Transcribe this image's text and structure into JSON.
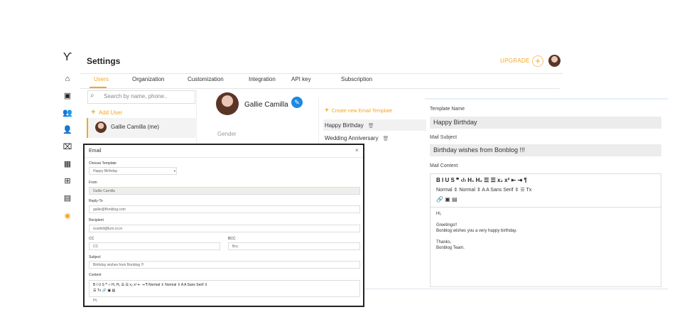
{
  "sidebar": {
    "icons": [
      "logo-icon",
      "home-icon",
      "contacts-icon",
      "team-icon",
      "add-user-icon",
      "briefcase-icon",
      "calendar-icon",
      "cart-icon",
      "reports-icon",
      "settings-icon"
    ]
  },
  "header": {
    "title": "Settings",
    "upgrade": "UPGRADE",
    "plus": "+"
  },
  "tabs": [
    "Users",
    "Organization",
    "Customization",
    "Integration",
    "API key",
    "Subscription"
  ],
  "users": {
    "search_placeholder": "Search by name, phone..",
    "add_user": "Add User",
    "list": [
      "Gallie Camilla (me)"
    ]
  },
  "profile": {
    "name": "Gallie Camilla",
    "gender_label": "Gender"
  },
  "templates": {
    "new_label": "Create new Email Template",
    "items": [
      "Happy Birthday",
      "Wedding Anniversary"
    ]
  },
  "editor": {
    "template_name_label": "Template Name",
    "template_name": "Happy Birthday",
    "subject_label": "Mail Subject",
    "subject": "Birthday wishes from Bonblog !!!",
    "content_label": "Mail Content",
    "toolbar_row1": "B   I   U   S     ❞   ‹/›     H₁  H₂     ☰  ☰    x₂  x²     ⇤  ⇥     ¶",
    "toolbar_row2": "Normal      ⇕      Normal      ⇕     A   A      Sans Serif    ⇕     ☰     Tx",
    "toolbar_row3": "🔗  ▣  ▤",
    "body_lines": [
      "Hi,",
      "",
      "Greetings!!",
      "Bonblog wishes you a very happy birthday.",
      "",
      "Thanks,",
      "Bonblog Team."
    ]
  },
  "modal": {
    "title": "Email",
    "close": "×",
    "choose_template_label": "Choose Template",
    "choose_template": "Happy Birthday",
    "from_label": "From",
    "from": "Gallie Camilla",
    "reply_label": "Reply-To",
    "reply": "gallie@Bonblog.com",
    "recipient_label": "Recipient",
    "recipient": "scarlett@lum.co.in",
    "cc_label": "CC",
    "cc_placeholder": "CC",
    "bcc_label": "BCC",
    "bcc_placeholder": "Bcc",
    "subject_label": "Subject",
    "subject": "Birthday wishes from Bonblog !!!",
    "content_label": "Content",
    "toolbar_row1": "B  I  U  S   ❞  ‹›   H₁  H₂   ☰  ☰   x₂  x²   ⇤  ⇥   ¶     Normal    ⇕     Normal    ⇕     A  A     Sans Serif    ⇕",
    "toolbar_row2": "☰   Tx   🔗  ▣  ▤",
    "body": "Hi,"
  }
}
